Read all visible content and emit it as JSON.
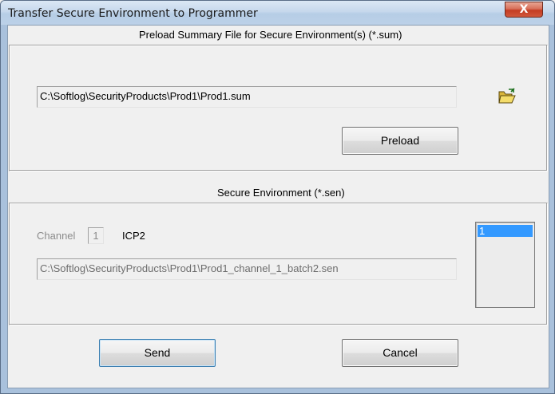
{
  "window": {
    "title": "Transfer Secure Environment to Programmer",
    "close_glyph": "X"
  },
  "preload": {
    "heading": "Preload Summary File for Secure Environment(s)  (*.sum)",
    "path_value": "C:\\Softlog\\SecurityProducts\\Prod1\\Prod1.sum",
    "browse_icon": "open-folder-icon",
    "button_label": "Preload"
  },
  "secure_environment": {
    "heading": "Secure Environment  (*.sen)",
    "channel_label": "Channel",
    "channel_value": "1",
    "device_label": "ICP2",
    "path_value": "C:\\Softlog\\SecurityProducts\\Prod1\\Prod1_channel_1_batch2.sen",
    "list_items": [
      "1"
    ]
  },
  "actions": {
    "send_label": "Send",
    "cancel_label": "Cancel"
  },
  "colors": {
    "selection": "#3399ff",
    "dialog_bg": "#f0f0f0",
    "close_button": "#c43c22"
  }
}
